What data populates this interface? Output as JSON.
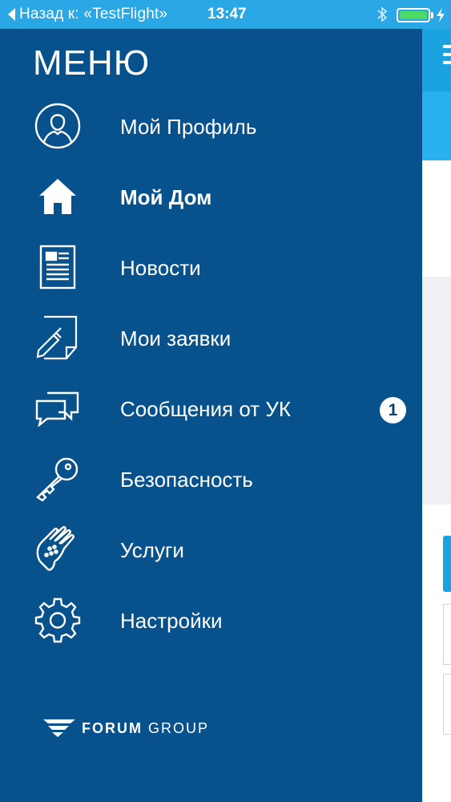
{
  "status_bar": {
    "back_label": "Назад к: «TestFlight»",
    "time": "13:47",
    "battery_color": "#4cd964"
  },
  "menu": {
    "title": "МЕНЮ",
    "items": [
      {
        "label": "Мой Профиль",
        "icon": "profile-icon"
      },
      {
        "label": "Мой Дом",
        "icon": "home-icon",
        "active": true
      },
      {
        "label": "Новости",
        "icon": "news-icon"
      },
      {
        "label": "Мои заявки",
        "icon": "requests-icon"
      },
      {
        "label": "Сообщения от УК",
        "icon": "messages-icon",
        "badge": "1"
      },
      {
        "label": "Безопасность",
        "icon": "key-icon"
      },
      {
        "label": "Услуги",
        "icon": "hand-icon"
      },
      {
        "label": "Настройки",
        "icon": "gear-icon"
      }
    ],
    "logo": {
      "bold": "FORUM",
      "regular": "GROUP"
    }
  },
  "colors": {
    "drawer_bg": "#07528c",
    "accent": "#1aa3e0",
    "status_bar": "#2aa8e5"
  }
}
